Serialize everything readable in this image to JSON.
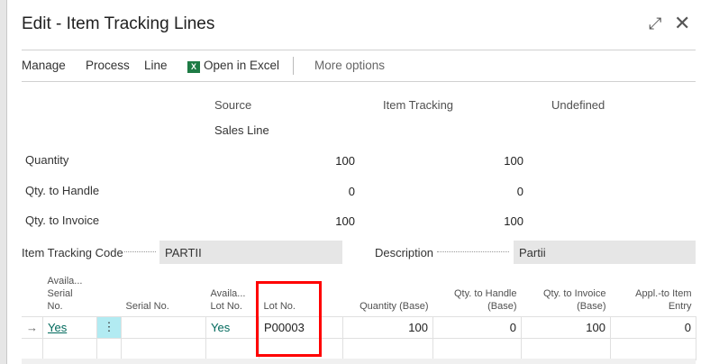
{
  "dialog": {
    "title": "Edit - Item Tracking Lines",
    "expand_icon": "expand-icon",
    "close_icon": "close-icon"
  },
  "toolbar": {
    "manage": "Manage",
    "process": "Process",
    "line": "Line",
    "excel": "Open in Excel",
    "more": "More options"
  },
  "summary": {
    "headers": [
      "Source",
      "Item Tracking",
      "Undefined"
    ],
    "source_name": "Sales Line",
    "rows": [
      {
        "label": "Quantity",
        "source": "100",
        "tracking": "100"
      },
      {
        "label": "Qty. to Handle",
        "source": "0",
        "tracking": "0"
      },
      {
        "label": "Qty. to Invoice",
        "source": "100",
        "tracking": "100"
      }
    ]
  },
  "fields": {
    "code_label": "Item Tracking Code",
    "code_value": "PARTII",
    "desc_label": "Description",
    "desc_value": "Partii"
  },
  "grid": {
    "headers": {
      "avail_serial": [
        "Availa...",
        "Serial",
        "No."
      ],
      "serial": "Serial No.",
      "avail_lot": [
        "Availa...",
        "Lot No."
      ],
      "lot": "Lot No.",
      "qty": "Quantity (Base)",
      "handle": [
        "Qty. to Handle",
        "(Base)"
      ],
      "invoice": [
        "Qty. to Invoice",
        "(Base)"
      ],
      "appl": [
        "Appl.-to Item",
        "Entry"
      ]
    },
    "rows": [
      {
        "arrow": "→",
        "avail_serial": "Yes",
        "dots": "⋮",
        "serial": "",
        "avail_lot": "Yes",
        "lot": "P00003",
        "qty": "100",
        "handle": "0",
        "invoice": "100",
        "appl": "0"
      }
    ]
  }
}
